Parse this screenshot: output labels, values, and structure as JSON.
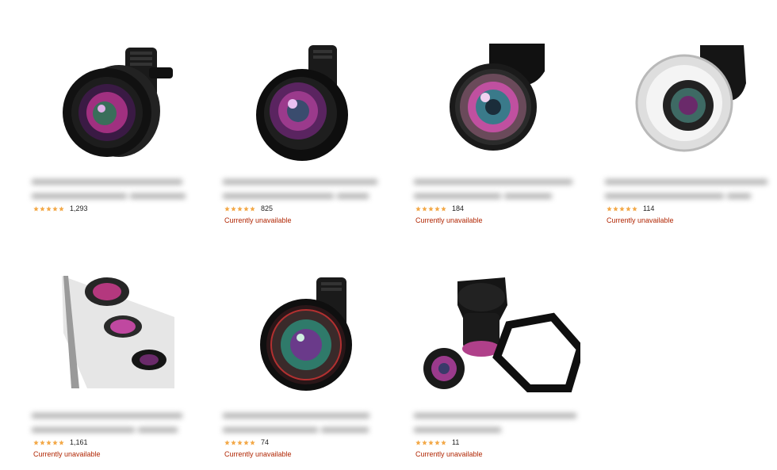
{
  "products": [
    {
      "rating_count": "1,293",
      "availability": "",
      "stars": 4.5
    },
    {
      "rating_count": "825",
      "availability": "Currently unavailable",
      "stars": 4.5
    },
    {
      "rating_count": "184",
      "availability": "Currently unavailable",
      "stars": 4.5
    },
    {
      "rating_count": "114",
      "availability": "Currently unavailable",
      "stars": 4.5
    },
    {
      "rating_count": "1,161",
      "availability": "Currently unavailable",
      "stars": 4.5
    },
    {
      "rating_count": "74",
      "availability": "Currently unavailable",
      "stars": 4.5
    },
    {
      "rating_count": "11",
      "availability": "Currently unavailable",
      "stars": 4.5
    }
  ],
  "colors": {
    "star_fill": "#f3a847",
    "star_empty": "#d5d5d5",
    "unavailable": "#b12704"
  }
}
